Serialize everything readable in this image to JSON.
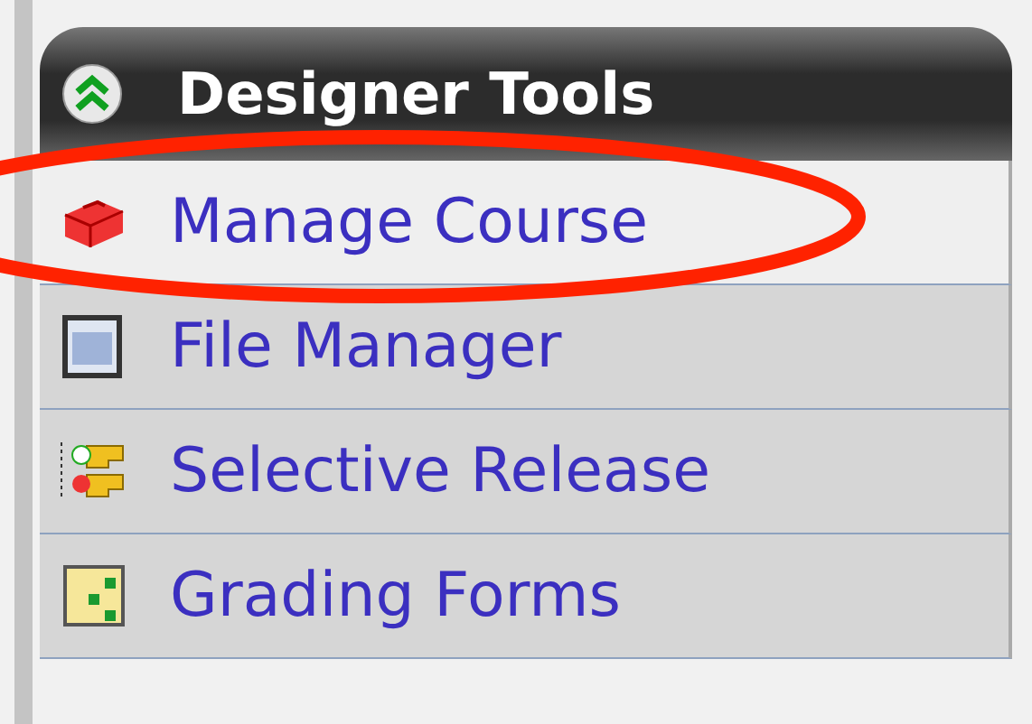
{
  "panel": {
    "title": "Designer Tools",
    "expanded": true,
    "items": [
      {
        "label": "Manage Course",
        "selected": true
      },
      {
        "label": "File Manager",
        "selected": false
      },
      {
        "label": "Selective Release",
        "selected": false
      },
      {
        "label": "Grading Forms",
        "selected": false
      }
    ]
  },
  "annotation": {
    "kind": "ellipse",
    "color": "#ff2200"
  }
}
